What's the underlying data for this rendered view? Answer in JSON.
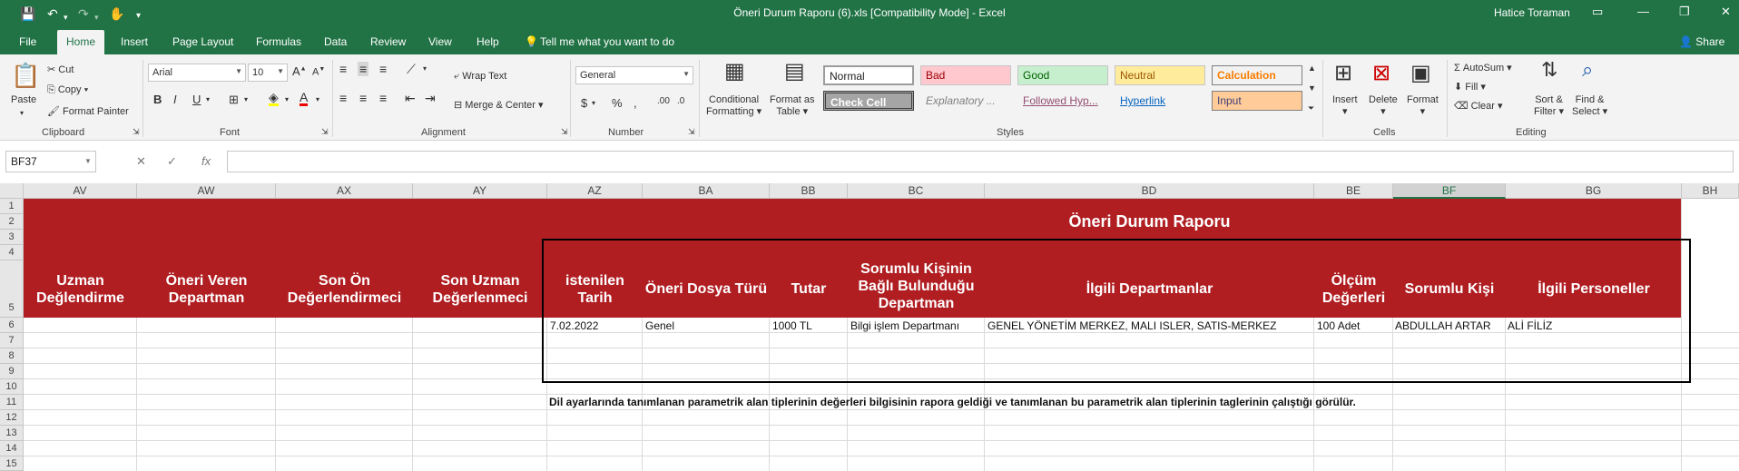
{
  "window": {
    "title": "Öneri Durum Raporu (6).xls  [Compatibility Mode]  -  Excel",
    "user": "Hatice Toraman"
  },
  "tabs": [
    "File",
    "Home",
    "Insert",
    "Page Layout",
    "Formulas",
    "Data",
    "Review",
    "View",
    "Help"
  ],
  "tell_me": "Tell me what you want to do",
  "share": "Share",
  "ribbon": {
    "clipboard": {
      "label": "Clipboard",
      "paste": "Paste",
      "cut": "Cut",
      "copy": "Copy",
      "format_painter": "Format Painter"
    },
    "font": {
      "label": "Font",
      "name": "Arial",
      "size": "10"
    },
    "alignment": {
      "label": "Alignment",
      "wrap": "Wrap Text",
      "merge": "Merge & Center"
    },
    "number": {
      "label": "Number",
      "format": "General"
    },
    "styles": {
      "label": "Styles",
      "conditional": "Conditional",
      "conditional2": "Formatting",
      "format_as": "Format as",
      "format_as2": "Table",
      "cells": [
        {
          "name": "Normal"
        },
        {
          "name": "Bad"
        },
        {
          "name": "Good"
        },
        {
          "name": "Neutral"
        },
        {
          "name": "Calculation"
        },
        {
          "name": "Check Cell"
        },
        {
          "name": "Explanatory ..."
        },
        {
          "name": "Followed Hyp..."
        },
        {
          "name": "Hyperlink"
        },
        {
          "name": "Input"
        }
      ]
    },
    "cells": {
      "label": "Cells",
      "insert": "Insert",
      "delete": "Delete",
      "format": "Format"
    },
    "editing": {
      "label": "Editing",
      "autosum": "AutoSum",
      "fill": "Fill",
      "clear": "Clear",
      "sort": "Sort &",
      "sort2": "Filter",
      "find": "Find &",
      "find2": "Select"
    }
  },
  "name_box": "BF37",
  "columns": [
    "AV",
    "AW",
    "AX",
    "AY",
    "AZ",
    "BA",
    "BB",
    "BC",
    "BD",
    "BE",
    "BF",
    "BG",
    "BH"
  ],
  "rows": [
    "1",
    "2",
    "3",
    "4",
    "5",
    "6",
    "7",
    "8",
    "9",
    "10",
    "11",
    "12",
    "13",
    "14",
    "15"
  ],
  "sheet": {
    "report_title": "Öneri Durum Raporu",
    "headers": {
      "av": "Uzman Değlendirme",
      "aw": "Öneri Veren Departman",
      "ax": "Son Ön Değerlendirmeci",
      "ay": "Son Uzman Değerlenmeci",
      "az": "istenilen Tarih",
      "ba": "Öneri Dosya Türü",
      "bb": "Tutar",
      "bc": "Sorumlu Kişinin Bağlı Bulunduğu Departman",
      "bd": "İlgili Departmanlar",
      "be": "Ölçüm Değerleri",
      "bf": "Sorumlu Kişi",
      "bg": "İlgili Personeller"
    },
    "row6": {
      "az": "7.02.2022",
      "ba": "Genel",
      "bb": "1000 TL",
      "bc": "Bilgi işlem Departmanı",
      "bd": "GENEL YÖNETİM MERKEZ, MALI ISLER, SATIS-MERKEZ",
      "be": "100 Adet",
      "bf": "ABDULLAH ARTAR",
      "bg": "ALİ FİLİZ"
    },
    "note": "Dil ayarlarında tanımlanan parametrik alan tiplerinin değerleri bilgisinin rapora geldiği ve tanımlanan bu parametrik alan tiplerinin taglerinin çalıştığı görülür."
  }
}
